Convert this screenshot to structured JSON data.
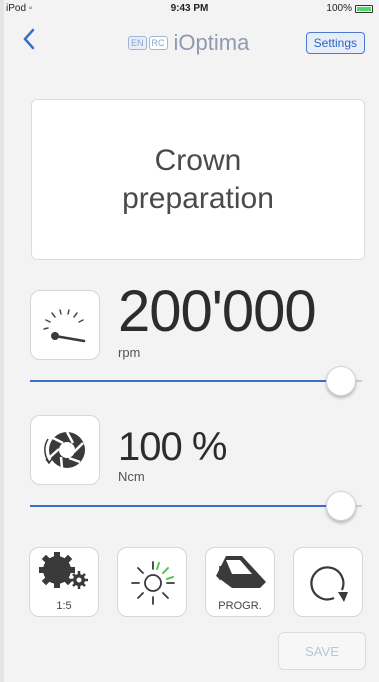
{
  "status": {
    "device": "iPod",
    "time": "9:43 PM",
    "battery": "100%",
    "battery_level": 1.0
  },
  "nav": {
    "back_icon": "chevron-left-icon",
    "logo_badge_en": "EN",
    "logo_badge_rc": "RC",
    "app_name": "iOptima",
    "settings_label": "Settings"
  },
  "program": {
    "name": "Crown preparation"
  },
  "speed": {
    "value": "200'000",
    "unit": "rpm",
    "icon": "speedometer-icon",
    "slider_level": 0.98
  },
  "torque": {
    "value": "100 %",
    "unit": "Ncm",
    "icon": "torque-icon",
    "slider_level": 0.98
  },
  "tools": {
    "ratio_label": "1:5",
    "ratio_icon": "gear-ratio-icon",
    "light_icon": "light-icon",
    "progr_label": "PROGR.",
    "progr_icon": "program-icon",
    "rotation_icon": "rotation-direction-icon"
  },
  "save_label": "SAVE",
  "colors": {
    "accent": "#3a6fc8",
    "background": "#f3f3f3",
    "battery": "#4cd964"
  }
}
